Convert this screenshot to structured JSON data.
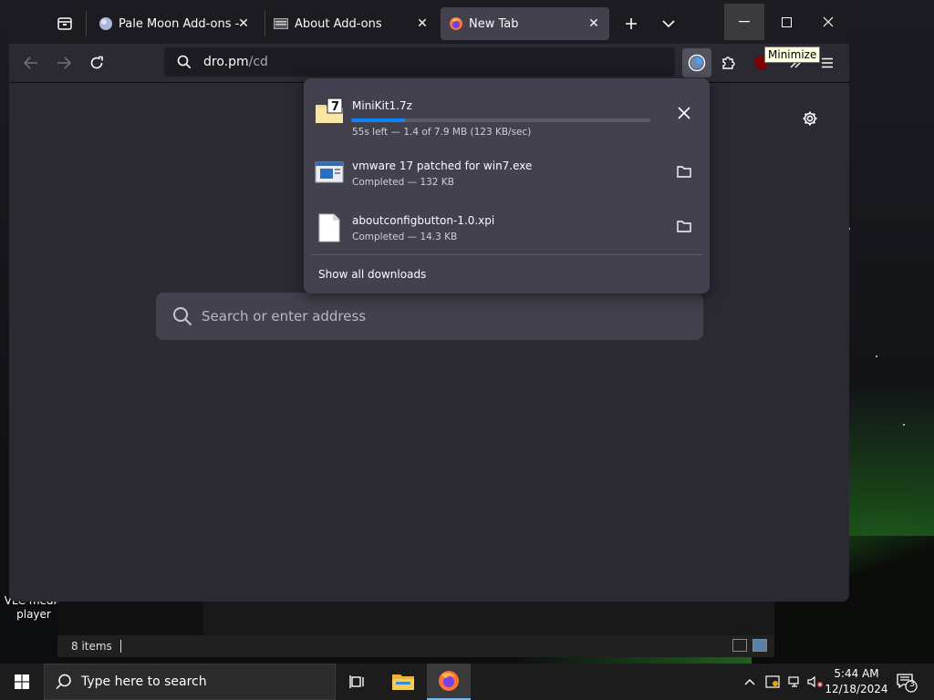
{
  "desktop": {
    "icon_label_line1": "VLC media",
    "icon_label_line2": "player"
  },
  "explorer": {
    "status_items": "8 items"
  },
  "browser": {
    "tabs": [
      {
        "title": "Pale Moon Add-ons - Ab",
        "icon": "pale-moon-icon"
      },
      {
        "title": "About Add-ons",
        "icon": "addons-icon"
      },
      {
        "title": "New Tab",
        "icon": "firefox-icon",
        "active": true
      }
    ],
    "url": {
      "host": "dro.pm",
      "path": "/cd"
    },
    "tooltip": "Minimize",
    "newtab_search_placeholder": "Search or enter address"
  },
  "downloads": {
    "items": [
      {
        "name": "MiniKit1.7z",
        "status": "55s left — 1.4 of 7.9 MB (123 KB/sec)",
        "progress": 0.18,
        "icon": "7z-archive-icon",
        "action": "cancel"
      },
      {
        "name": "vmware 17 patched for win7.exe",
        "status": "Completed — 132 KB",
        "icon": "exe-file-icon",
        "action": "open-folder"
      },
      {
        "name": "aboutconfigbutton-1.0.xpi",
        "status": "Completed — 14.3 KB",
        "icon": "generic-file-icon",
        "action": "open-folder"
      }
    ],
    "show_all": "Show all downloads"
  },
  "taskbar": {
    "search_placeholder": "Type here to search",
    "time": "5:44 AM",
    "date": "12/18/2024",
    "notification_count": "3"
  },
  "colors": {
    "accent": "#0a84ff",
    "panel": "#42414d",
    "toolbar": "#2b2a33",
    "tabbar": "#1c1b22"
  }
}
